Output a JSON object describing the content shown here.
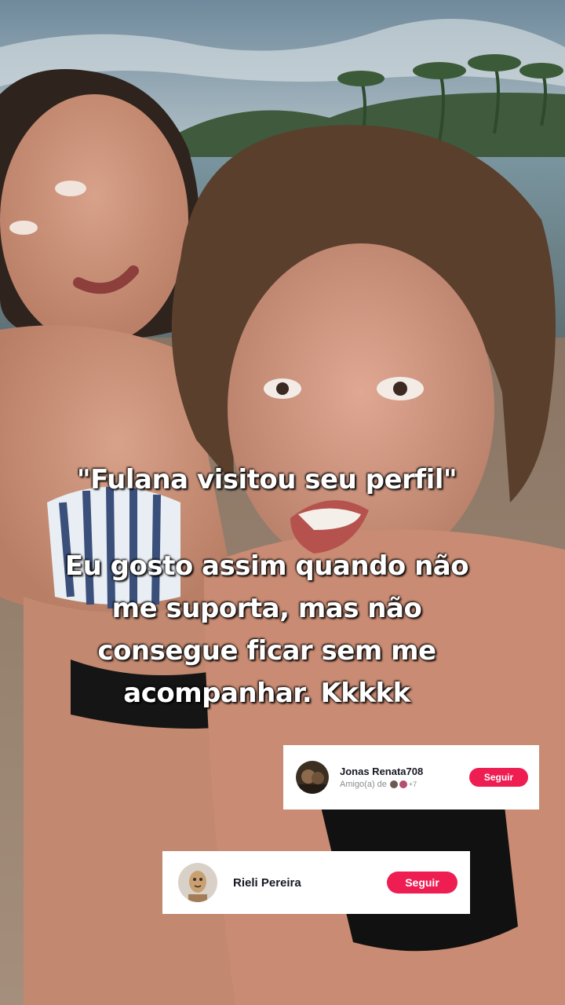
{
  "caption": {
    "line1": "\"Fulana visitou seu perfil\"",
    "line2": "Eu gosto assim quando não me suporta, mas não consegue ficar sem me acompanhar. Kkkkk"
  },
  "suggestions": [
    {
      "name": "Jonas Renata708",
      "subtitle_prefix": "Amigo(a) de",
      "subtitle_count": "+7",
      "button_label": "Seguir"
    },
    {
      "name": "Rieli Pereira",
      "button_label": "Seguir"
    }
  ],
  "colors": {
    "button": "#ee1d52",
    "caption_text": "#ffffff"
  }
}
